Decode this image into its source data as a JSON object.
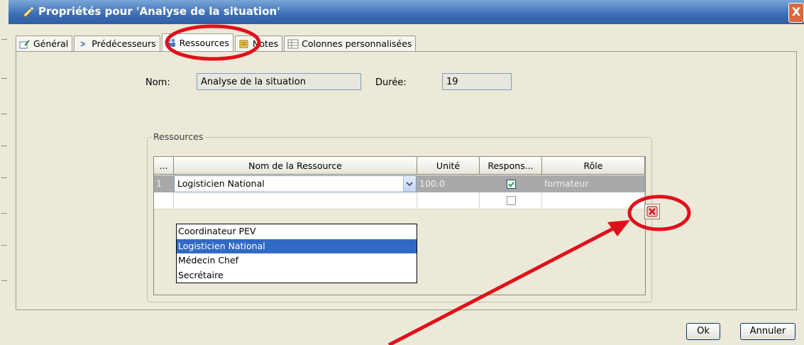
{
  "window": {
    "title": "Propriétés pour 'Analyse de la situation'",
    "close_label": "X"
  },
  "tabs": [
    {
      "label": "Général",
      "icon": "edit-icon"
    },
    {
      "label": "Prédécesseurs",
      "icon": "arrow-icon"
    },
    {
      "label": "Ressources",
      "icon": "people-icon",
      "active": true
    },
    {
      "label": "Notes",
      "icon": "note-icon"
    },
    {
      "label": "Colonnes personnalisées",
      "icon": "table-icon"
    }
  ],
  "form": {
    "name_label": "Nom:",
    "name_value": "Analyse de la situation",
    "duration_label": "Durée:",
    "duration_value": "19"
  },
  "resources": {
    "group_title": "Ressources",
    "columns": [
      "...",
      "Nom de la Ressource",
      "Unité",
      "Respons...",
      "Rôle"
    ],
    "rows": [
      {
        "index": "1",
        "name": "Logisticien National",
        "unit": "100.0",
        "responsible": true,
        "role": "formateur",
        "selected": true
      },
      {
        "index": "",
        "name": "",
        "unit": "",
        "responsible": false,
        "role": ""
      }
    ],
    "dropdown_options": [
      "Coordinateur PEV",
      "Logisticien National",
      "Médecin Chef",
      "Secrétaire"
    ],
    "highlighted_option": "Logisticien National"
  },
  "buttons": {
    "ok": "Ok",
    "cancel": "Annuler"
  },
  "colors": {
    "title_bar": "#3b6db4",
    "dialog_bg": "#ece9d8",
    "selection": "#316ac5",
    "annotation": "#e0101a"
  }
}
